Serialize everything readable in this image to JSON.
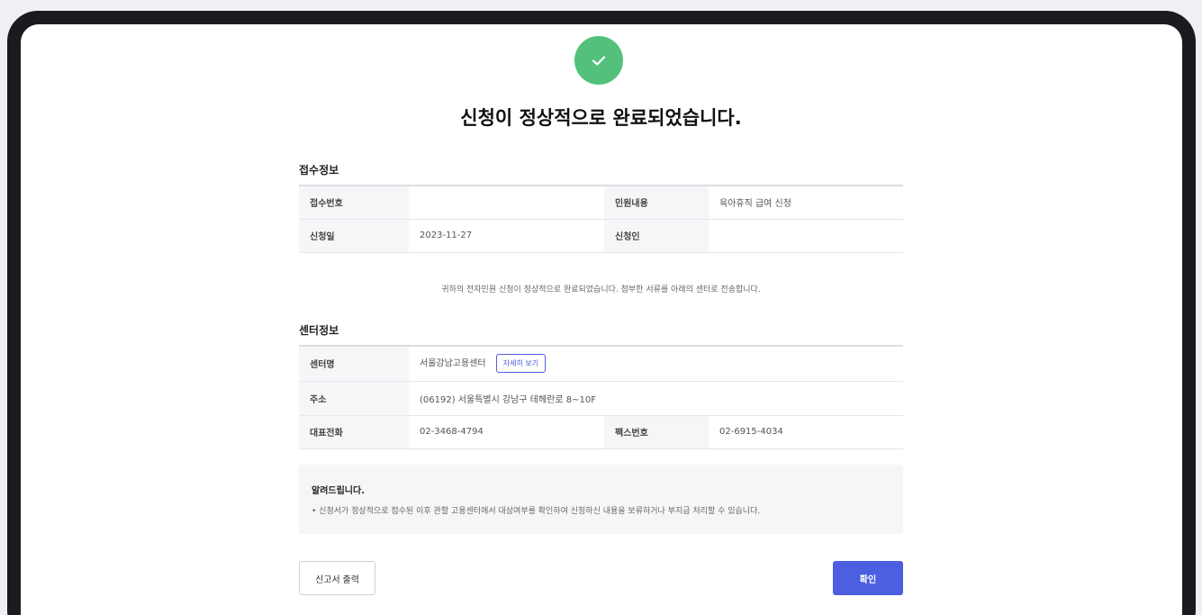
{
  "page": {
    "title": "신청이 정상적으로 완료되었습니다."
  },
  "icons": {
    "success": "check-circle-icon",
    "success_color": "#53c17c"
  },
  "receipt": {
    "section_title": "접수정보",
    "receipt_no_label": "접수번호",
    "receipt_no_value": "",
    "request_type_label": "민원내용",
    "request_type_value": "육아휴직 급여 신청",
    "date_label": "신청일",
    "date_value": "2023-11-27",
    "applicant_label": "신청인",
    "applicant_value": ""
  },
  "notice": "귀하의 전자민원 신청이 정상적으로 완료되었습니다. 첨부한 서류를 아래의 센터로 전송합니다.",
  "center": {
    "section_title": "센터정보",
    "name_label": "센터명",
    "name_value": "서울강남고용센터",
    "detail_button": "자세히 보기",
    "address_label": "주소",
    "address_value": "(06192) 서울특별시 강남구 테헤란로 8~10F",
    "phone_label": "대표전화",
    "phone_value": "02-3468-4794",
    "fax_label": "팩스번호",
    "fax_value": "02-6915-4034"
  },
  "alert": {
    "title": "알려드립니다.",
    "body": "• 신청서가 정상적으로 접수된 이후 관할 고용센터에서 대상여부를 확인하여 신청하신 내용을 보류하거나 부지급 처리할 수 있습니다."
  },
  "buttons": {
    "print": "신고서 출력",
    "confirm": "확인",
    "primary_color": "#4b5fe0"
  }
}
